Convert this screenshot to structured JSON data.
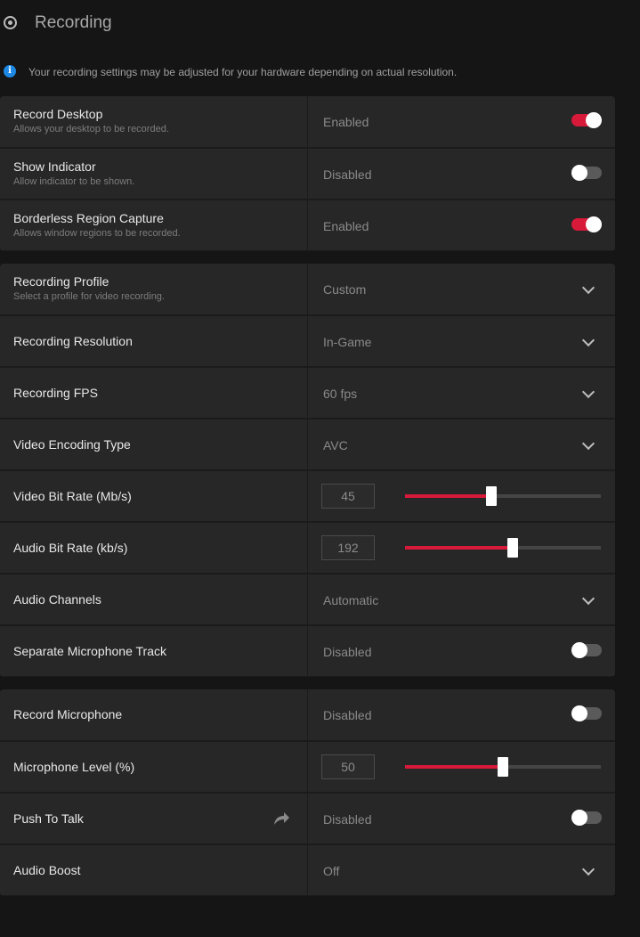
{
  "header": {
    "title": "Recording",
    "icon": "record-icon"
  },
  "notice": {
    "text": "Your recording settings may be adjusted for your hardware depending on actual resolution.",
    "icon": "info-icon"
  },
  "colors": {
    "accent": "#d7193a",
    "info": "#1e88e5",
    "background": "#151515",
    "row": "#272727"
  },
  "groups": {
    "capture": {
      "record_desktop": {
        "label": "Record Desktop",
        "desc": "Allows your desktop to be recorded.",
        "value": "Enabled",
        "on": true
      },
      "show_indicator": {
        "label": "Show Indicator",
        "desc": "Allow indicator to be shown.",
        "value": "Disabled",
        "on": false
      },
      "borderless": {
        "label": "Borderless Region Capture",
        "desc": "Allows window regions to be recorded.",
        "value": "Enabled",
        "on": true
      }
    },
    "video": {
      "profile": {
        "label": "Recording Profile",
        "desc": "Select a profile for video recording.",
        "value": "Custom"
      },
      "resolution": {
        "label": "Recording Resolution",
        "value": "In-Game"
      },
      "fps": {
        "label": "Recording FPS",
        "value": "60 fps"
      },
      "encoding": {
        "label": "Video Encoding Type",
        "value": "AVC"
      },
      "video_bitrate": {
        "label": "Video Bit Rate (Mb/s)",
        "value": "45",
        "fraction": 0.44
      },
      "audio_bitrate": {
        "label": "Audio Bit Rate (kb/s)",
        "value": "192",
        "fraction": 0.55
      },
      "audio_channels": {
        "label": "Audio Channels",
        "value": "Automatic"
      },
      "separate_mic": {
        "label": "Separate Microphone Track",
        "value": "Disabled",
        "on": false
      }
    },
    "mic": {
      "record_mic": {
        "label": "Record Microphone",
        "value": "Disabled",
        "on": false
      },
      "mic_level": {
        "label": "Microphone Level (%)",
        "value": "50",
        "fraction": 0.5
      },
      "push_to_talk": {
        "label": "Push To Talk",
        "value": "Disabled",
        "on": false,
        "icon": "share-arrow-icon"
      },
      "audio_boost": {
        "label": "Audio Boost",
        "value": "Off"
      }
    }
  }
}
